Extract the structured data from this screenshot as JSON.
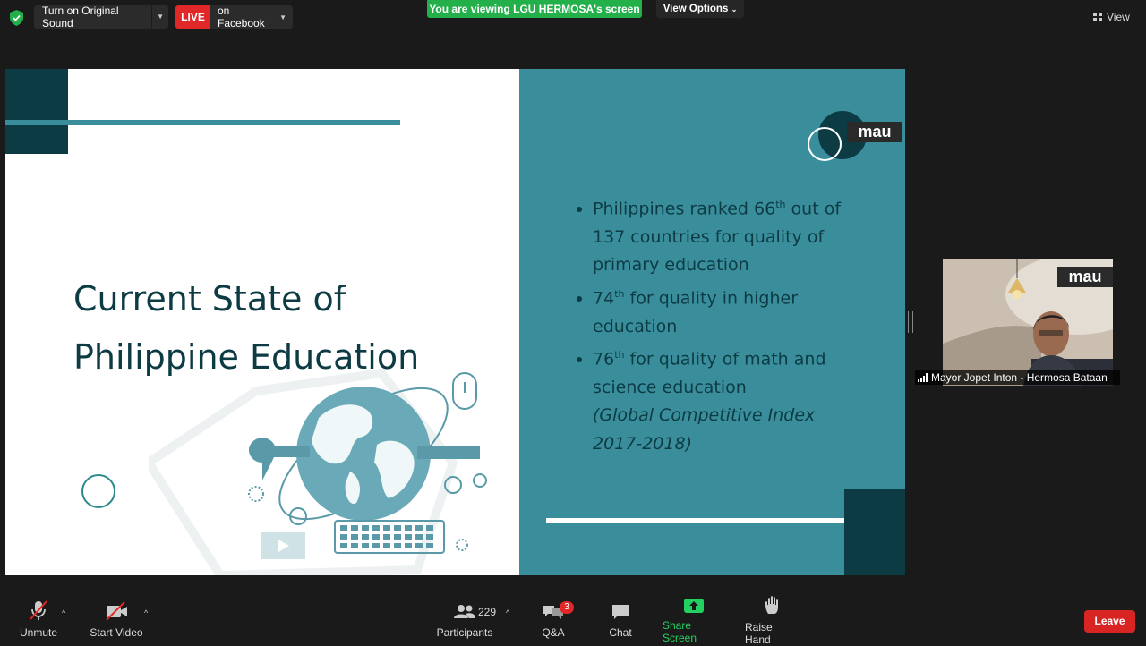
{
  "topbar": {
    "original_sound_label": "Turn on Original Sound",
    "live_badge": "LIVE",
    "live_destination": "on Facebook",
    "viewing_banner": "You are viewing LGU HERMOSA's screen",
    "view_options_label": "View Options",
    "view_label": "View"
  },
  "slide": {
    "title_line1": "Current State of",
    "title_line2": "Philippine Education",
    "watermark": "mau",
    "bullets": {
      "b1_pre": "Philippines ranked 66",
      "b1_sup": "th",
      "b1_post": " out of 137 countries for quality of primary education",
      "b2_pre": "74",
      "b2_sup": "th",
      "b2_post": " for quality in higher education",
      "b3_pre": "76",
      "b3_sup": "th",
      "b3_post": " for quality of math and science education"
    },
    "citation": "(Global Competitive Index 2017-2018)"
  },
  "participant": {
    "name": "Mayor Jopet Inton - Hermosa Bataan",
    "watermark": "mau"
  },
  "toolbar": {
    "unmute": "Unmute",
    "start_video": "Start Video",
    "participants": "Participants",
    "participant_count": "229",
    "qa": "Q&A",
    "qa_badge": "3",
    "chat": "Chat",
    "share_screen": "Share Screen",
    "raise_hand": "Raise Hand",
    "leave": "Leave"
  },
  "colors": {
    "live_red": "#e02828",
    "banner_green": "#23b04b",
    "slide_teal": "#3a8e9c",
    "slide_dark": "#0c3b44",
    "leave_red": "#d92424"
  }
}
